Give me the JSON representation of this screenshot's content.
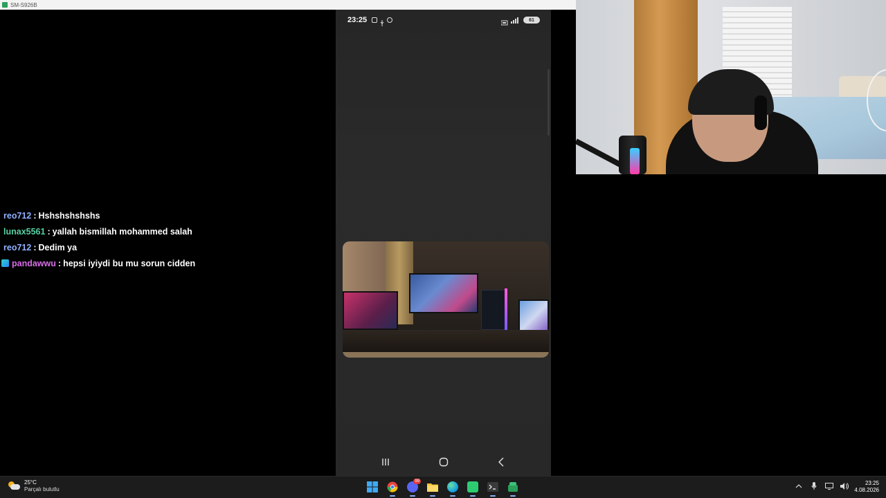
{
  "window": {
    "title": "SM-S926B"
  },
  "chat": {
    "messages": [
      {
        "user": "reo712",
        "user_color": "#8fb1ff",
        "sep": ":",
        "text": "Hshshshshshs",
        "badge": false
      },
      {
        "user": "lunax5561",
        "user_color": "#58d0a3",
        "sep": ":",
        "text": "yallah bismillah mohammed salah",
        "badge": false
      },
      {
        "user": "reo712",
        "user_color": "#8fb1ff",
        "sep": ":",
        "text": "Dedim ya",
        "badge": false
      },
      {
        "user": "pandawwu",
        "user_color": "#d86ee8",
        "sep": ":",
        "text": "hepsi iyiydi bu mu sorun cidden",
        "badge": true
      }
    ]
  },
  "phone": {
    "status": {
      "time": "23:25",
      "battery": "61"
    },
    "nav": {
      "recents": "recents-icon",
      "home": "home-icon",
      "back": "back-icon"
    }
  },
  "taskbar": {
    "weather": {
      "temp": "25°C",
      "desc": "Parçalı bulutlu"
    },
    "apps": [
      {
        "name": "windows-start-icon",
        "color": "#2f8cff",
        "badge": ""
      },
      {
        "name": "chrome-icon",
        "color": "#e8453c",
        "badge": ""
      },
      {
        "name": "discord-icon",
        "color": "#5865f2",
        "badge": "99"
      },
      {
        "name": "file-explorer-icon",
        "color": "#f4c33a",
        "badge": ""
      },
      {
        "name": "edge-icon",
        "color": "#1aa3e0",
        "badge": ""
      },
      {
        "name": "scrcpy-icon",
        "color": "#2ecc71",
        "badge": ""
      },
      {
        "name": "terminal-icon",
        "color": "#3a3a3a",
        "badge": ""
      },
      {
        "name": "android-mirror-icon",
        "color": "#2aa05a",
        "badge": ""
      }
    ],
    "clock": {
      "time": "23:25",
      "date": "4.08.2026"
    }
  }
}
